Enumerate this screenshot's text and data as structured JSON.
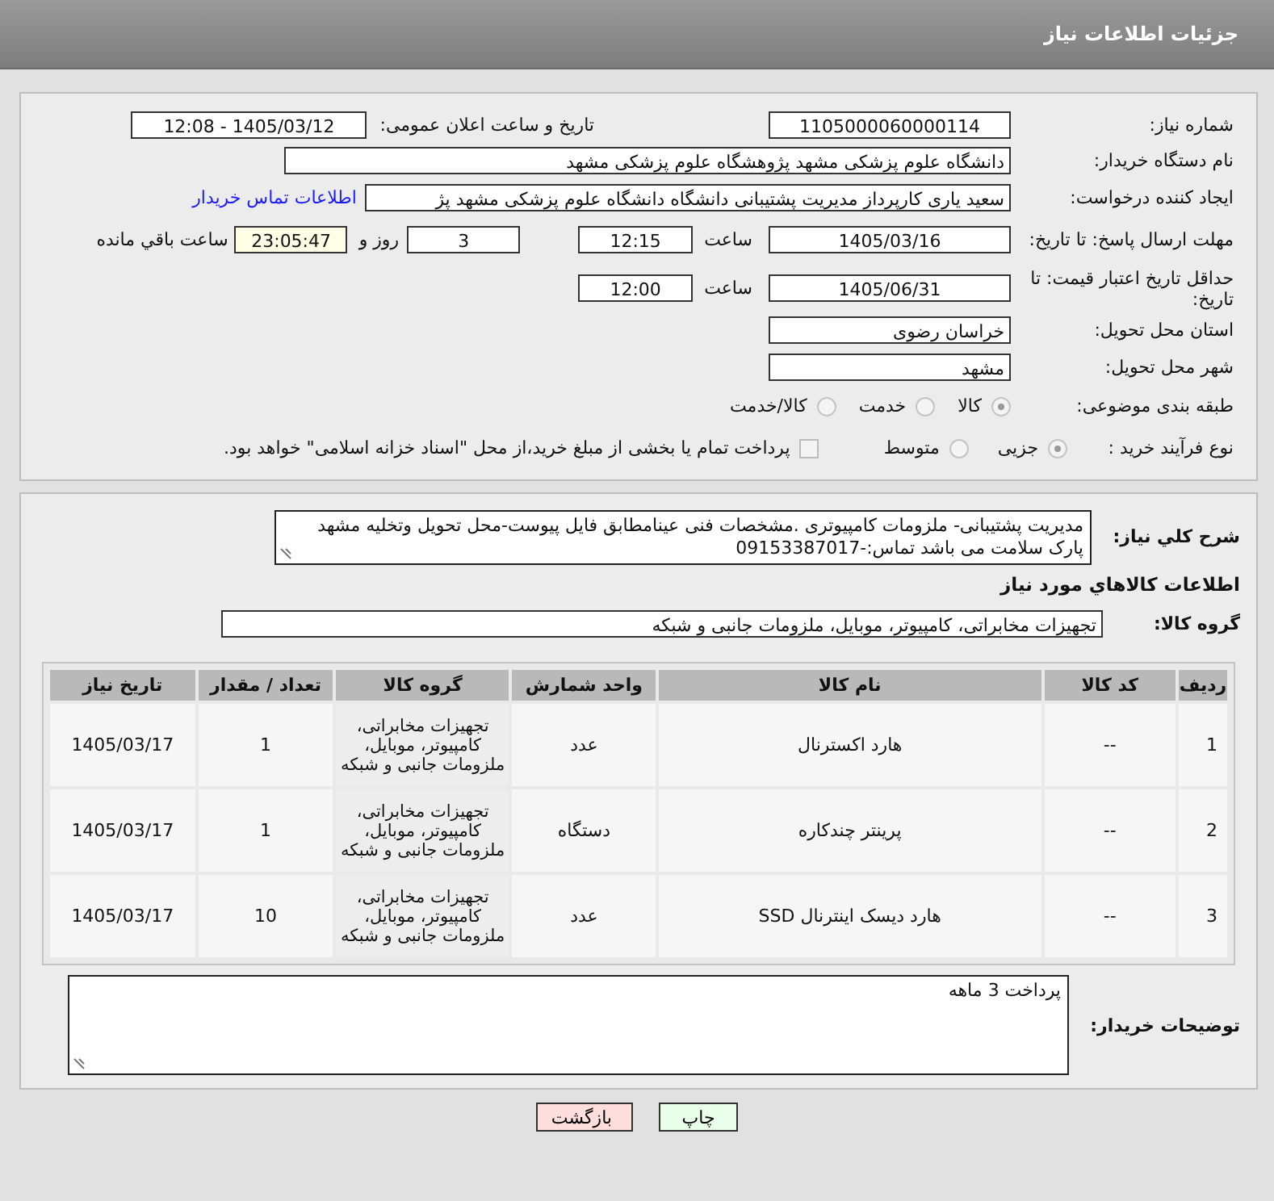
{
  "window": {
    "title": "جزئیات اطلاعات نیاز"
  },
  "form": {
    "need_number": {
      "label": "شماره نیاز:",
      "value": "1105000060000114"
    },
    "announce_date": {
      "label": "تاریخ و ساعت اعلان عمومی:",
      "value": "1405/03/12 - 12:08"
    },
    "buyer_org": {
      "label": "نام دستگاه خریدار:",
      "value": "دانشگاه علوم پزشکی مشهد   پژوهشگاه علوم پزشکی مشهد"
    },
    "requester": {
      "label": "ایجاد کننده درخواست:",
      "value": "سعید یاری کارپرداز مدیریت پشتیبانی دانشگاه دانشگاه علوم پزشکی مشهد   پژ",
      "link": "اطلاعات تماس خریدار"
    },
    "reply_deadline": {
      "label": "مهلت ارسال پاسخ: تا تاریخ:",
      "date": "1405/03/16",
      "time_label": "ساعت",
      "time": "12:15",
      "days": "3",
      "days_label": "روز و",
      "remaining": "23:05:47",
      "remaining_label": "ساعت باقي مانده"
    },
    "price_validity": {
      "label": "حداقل تاریخ اعتبار قیمت: تا تاریخ:",
      "date": "1405/06/31",
      "time_label": "ساعت",
      "time": "12:00"
    },
    "province": {
      "label": "استان محل تحویل:",
      "value": "خراسان رضوی"
    },
    "city": {
      "label": "شهر محل تحویل:",
      "value": "مشهد"
    },
    "category": {
      "label": "طبقه بندی موضوعی:",
      "options": [
        {
          "label": "کالا",
          "selected": true
        },
        {
          "label": "خدمت",
          "selected": false
        },
        {
          "label": "کالا/خدمت",
          "selected": false
        }
      ]
    },
    "process": {
      "label": "نوع فرآیند خرید :",
      "options": [
        {
          "label": "جزیی",
          "selected": true
        },
        {
          "label": "متوسط",
          "selected": false
        }
      ],
      "treasury": {
        "label": "پرداخت تمام یا بخشی از مبلغ خرید،از محل \"اسناد خزانه اسلامی\" خواهد بود.",
        "checked": false
      }
    }
  },
  "description": {
    "label": "شرح كلي نياز:",
    "value": "مدیریت پشتیبانی- ملزومات کامپیوتری .مشخصات فنی عینامطابق فایل پیوست-محل تحویل وتخلیه مشهد پارک سلامت  می باشد تماس:-09153387017"
  },
  "items_title": "اطلاعات كالاهاي مورد نياز",
  "goods_group": {
    "label": "گروه کالا:",
    "value": "تجهیزات مخابراتی، کامپیوتر، موبایل، ملزومات جانبی و شبکه"
  },
  "table": {
    "columns": [
      "ردیف",
      "کد کالا",
      "نام کالا",
      "واحد شمارش",
      "گروه کالا",
      "تعداد / مقدار",
      "تاریخ نیاز"
    ],
    "rows": [
      [
        "1",
        "--",
        "هارد اکسترنال",
        "عدد",
        "تجهیزات مخابراتی، کامپیوتر، موبایل، ملزومات جانبی و شبکه",
        "1",
        "1405/03/17"
      ],
      [
        "2",
        "--",
        "پرینتر چندکاره",
        "دستگاه",
        "تجهیزات مخابراتی، کامپیوتر، موبایل، ملزومات جانبی و شبکه",
        "1",
        "1405/03/17"
      ],
      [
        "3",
        "--",
        "هارد دیسک اینترنال SSD",
        "عدد",
        "تجهیزات مخابراتی، کامپیوتر، موبایل، ملزومات جانبی و شبکه",
        "10",
        "1405/03/17"
      ]
    ]
  },
  "buyer_notes": {
    "label": "توضیحات خریدار:",
    "value": "پرداخت 3 ماهه"
  },
  "buttons": [
    {
      "label": "چاپ",
      "kind": "print"
    },
    {
      "label": "بازگشت",
      "kind": "back"
    }
  ]
}
